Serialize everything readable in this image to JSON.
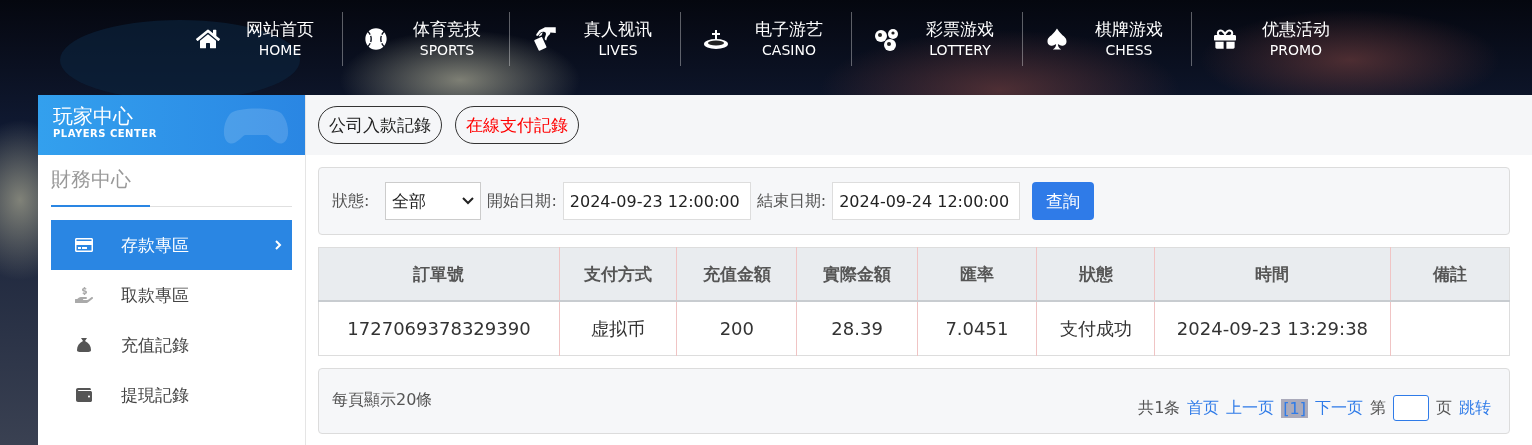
{
  "nav": [
    {
      "title": "网站首页",
      "subtitle": "HOME"
    },
    {
      "title": "体育竞技",
      "subtitle": "SPORTS"
    },
    {
      "title": "真人视讯",
      "subtitle": "LIVES"
    },
    {
      "title": "电子游艺",
      "subtitle": "CASINO"
    },
    {
      "title": "彩票游戏",
      "subtitle": "LOTTERY"
    },
    {
      "title": "棋牌游戏",
      "subtitle": "CHESS"
    },
    {
      "title": "优惠活动",
      "subtitle": "PROMO"
    }
  ],
  "sidebar": {
    "title": "玩家中心",
    "subtitle": "PLAYERS CENTER",
    "section": "財務中心",
    "items": [
      {
        "label": "存款專區",
        "selected": true
      },
      {
        "label": "取款專區",
        "selected": false
      },
      {
        "label": "充值記錄",
        "selected": false
      },
      {
        "label": "提現記錄",
        "selected": false
      }
    ]
  },
  "tabs": [
    {
      "label": "公司入款記錄",
      "selected": false
    },
    {
      "label": "在線支付記錄",
      "selected": true
    }
  ],
  "filter": {
    "status_label": "狀態:",
    "status_value": "全部",
    "start_label": "開始日期:",
    "start_value": "2024-09-23 12:00:00",
    "end_label": "結束日期:",
    "end_value": "2024-09-24 12:00:00",
    "button": "查詢"
  },
  "table": {
    "columns": [
      "訂單號",
      "支付方式",
      "充值金額",
      "實際金額",
      "匯率",
      "狀態",
      "時間",
      "備註"
    ],
    "rows": [
      [
        "1727069378329390",
        "虚拟币",
        "200",
        "28.39",
        "7.0451",
        "支付成功",
        "2024-09-23 13:29:38",
        ""
      ]
    ]
  },
  "pager": {
    "per_page": "每頁顯示20條",
    "total": "共1条",
    "first": "首页",
    "prev": "上一页",
    "current": "[1]",
    "next": "下一页",
    "page_prefix": "第",
    "page_suffix": "页",
    "go": "跳转"
  }
}
